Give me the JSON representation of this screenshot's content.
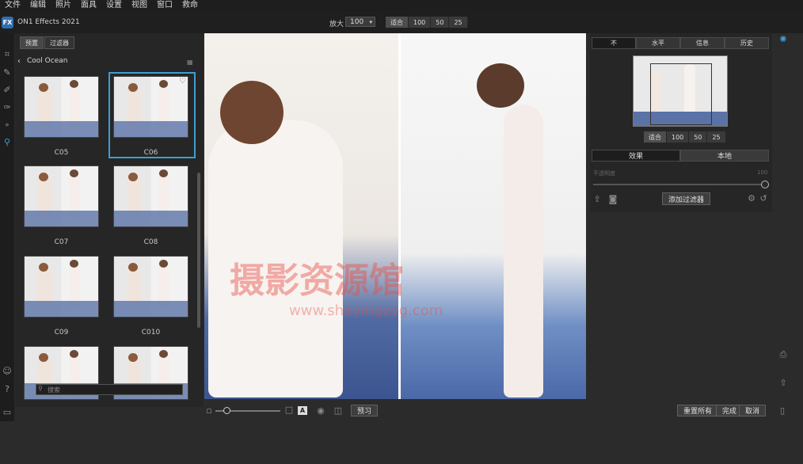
{
  "menu": [
    "文件",
    "编辑",
    "照片",
    "面具",
    "设置",
    "视图",
    "窗口",
    "救命"
  ],
  "app": {
    "logo_text": "FX",
    "title": "ON1 Effects 2021"
  },
  "zoom": {
    "label": "放大",
    "value": "100",
    "fit_options": [
      "适合",
      "100",
      "50",
      "25"
    ]
  },
  "browser": {
    "tabs": [
      "预置",
      "过滤器"
    ],
    "category": "Cool Ocean",
    "presets": [
      {
        "name": "C05"
      },
      {
        "name": "C06",
        "selected": true
      },
      {
        "name": "C07"
      },
      {
        "name": "C08"
      },
      {
        "name": "C09"
      },
      {
        "name": "C010"
      },
      {
        "name": ""
      },
      {
        "name": ""
      }
    ],
    "search_placeholder": "搜索"
  },
  "right": {
    "view_modes": [
      "不",
      "水平",
      "信息",
      "历史"
    ],
    "nav_fit": [
      "适合",
      "100",
      "50",
      "25"
    ],
    "tabs": [
      "效果",
      "本地"
    ],
    "opacity_label": "不透明度",
    "opacity_value": "100",
    "add_filter": "添加过滤器"
  },
  "bottom": {
    "preview": "预习",
    "reset_all": "重置所有",
    "done": "完成",
    "cancel": "取消",
    "a_label": "A"
  },
  "watermark": {
    "line1": "摄影资源馆",
    "line2": "www.sheyingzyg.com"
  },
  "colors": {
    "accent": "#3e9ed6",
    "bg": "#2b2b2b",
    "panel": "#262626"
  }
}
